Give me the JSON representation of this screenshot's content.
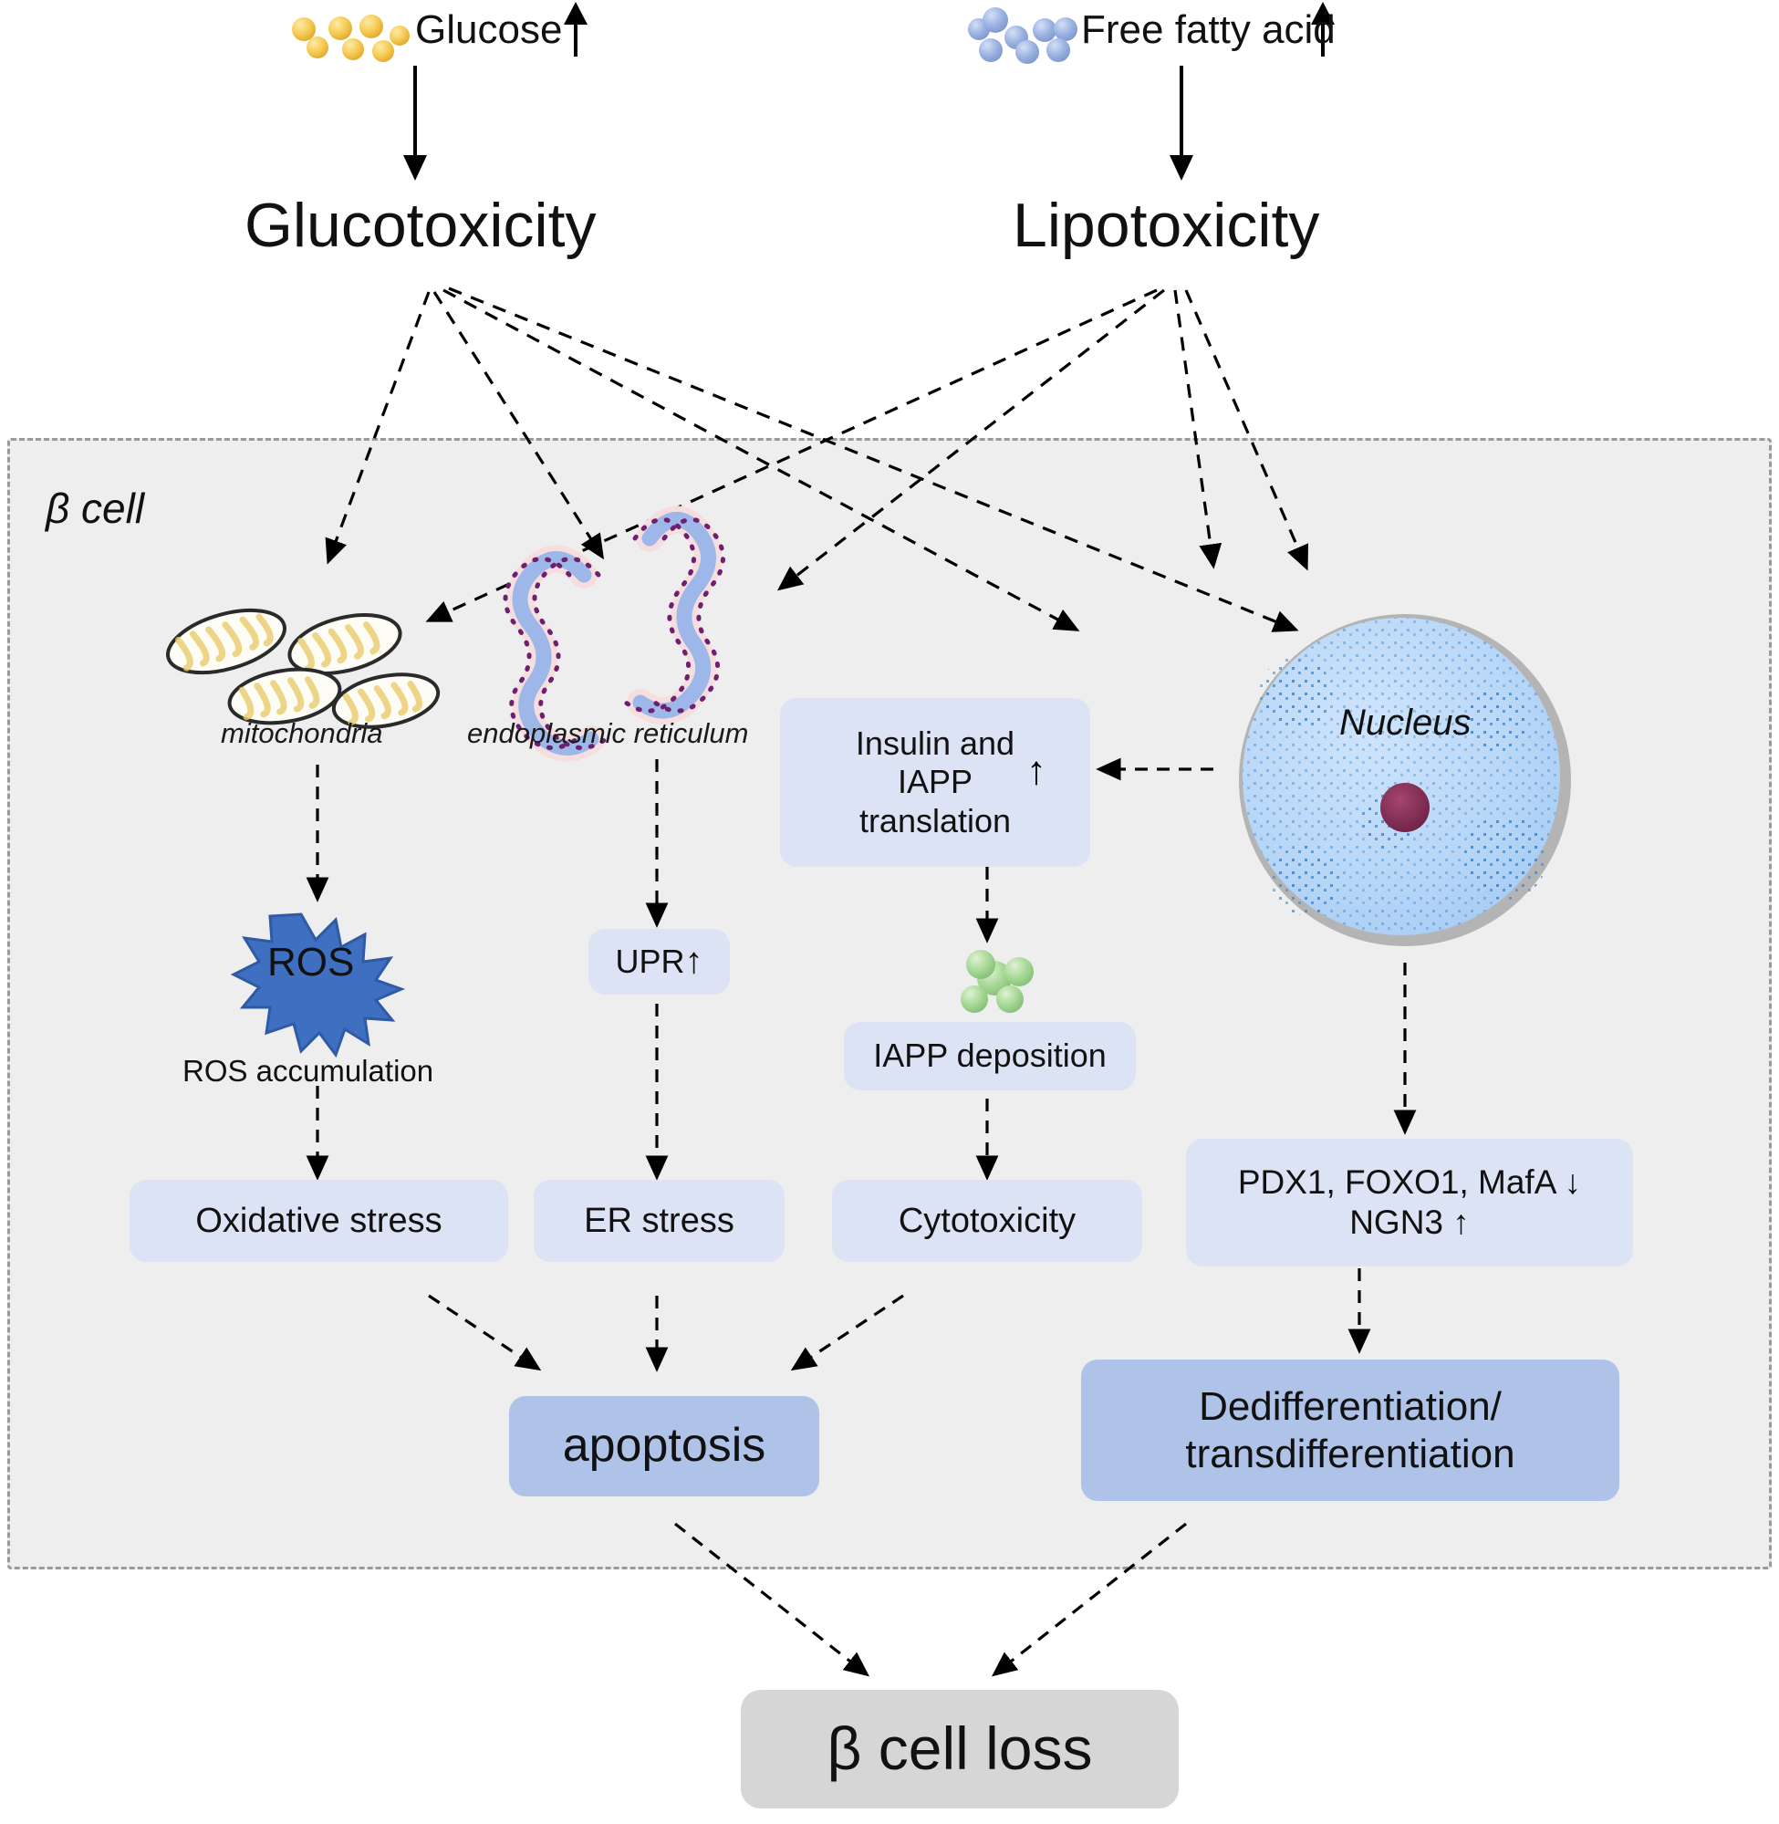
{
  "diagram": {
    "title_glucose_pathway": "Glucotoxicity",
    "title_lipid_pathway": "Lipotoxicity"
  },
  "inputs": [
    {
      "id": "glucose",
      "label": "Glucose",
      "trend": "↑",
      "granule_color": "#f5c242",
      "granule_name": "glucose-granules"
    },
    {
      "id": "free_fatty_acid",
      "label": "Free fatty acid",
      "trend": "↑",
      "granule_color": "#9cb4e3",
      "granule_name": "fatty-acid-granules"
    }
  ],
  "toxicity": {
    "gluco": "Glucotoxicity",
    "lipo": "Lipotoxicity"
  },
  "cell": {
    "label": "β cell",
    "background": "#eeeeee",
    "border": "#9a9a9a"
  },
  "organelles": [
    {
      "id": "mitochondria",
      "label": "mitochondria"
    },
    {
      "id": "endoplasmic_reticulum",
      "label": "endoplasmic reticulum"
    },
    {
      "id": "nucleus",
      "label": "Nucleus"
    }
  ],
  "nodes": {
    "insulin_iapp_translation": {
      "label": "Insulin and\nIAPP\ntranslation",
      "trend": "↑",
      "color": "#dbe3f5"
    },
    "ros_burst": {
      "label": "ROS",
      "color": "#3f6fc0"
    },
    "ros_accumulation": {
      "label": "ROS accumulation"
    },
    "upr": {
      "label": "UPR",
      "trend": "↑",
      "color": "#dbe3f5"
    },
    "iapp_deposition": {
      "label": "IAPP deposition",
      "color": "#dbe3f5",
      "granule_color": "#a9d99a"
    },
    "oxidative_stress": {
      "label": "Oxidative stress",
      "color": "#dbe3f5"
    },
    "er_stress": {
      "label": "ER stress",
      "color": "#dbe3f5"
    },
    "cytotoxicity": {
      "label": "Cytotoxicity",
      "color": "#dbe3f5"
    },
    "transcription_factors": {
      "line1": "PDX1, FOXO1, MafA ↓",
      "line2": "NGN3 ↑",
      "color": "#dbe3f5"
    },
    "apoptosis": {
      "label": "apoptosis",
      "color": "#aec3e7"
    },
    "dedifferentiation": {
      "line1": "Dedifferentiation/",
      "line2": "transdifferentiation",
      "color": "#aec3e7"
    },
    "beta_cell_loss": {
      "label": "β cell loss",
      "color": "#d6d6d6"
    }
  },
  "colors": {
    "arrow": "#000000",
    "box_light": "#dbe3f5",
    "box_mid": "#aec3e7",
    "box_gray": "#d6d6d6",
    "cell_bg": "#eeeeee",
    "nucleus_fill": "#b9d7f7",
    "nucleus_rim": "#b4b4b4",
    "nucleolus": "#7b2a4e",
    "chromatin": "#2b7fd4",
    "ros_fill": "#3f6fc0",
    "er_membrane": "#6f1f6f",
    "er_lumen": "#9db8e8"
  }
}
